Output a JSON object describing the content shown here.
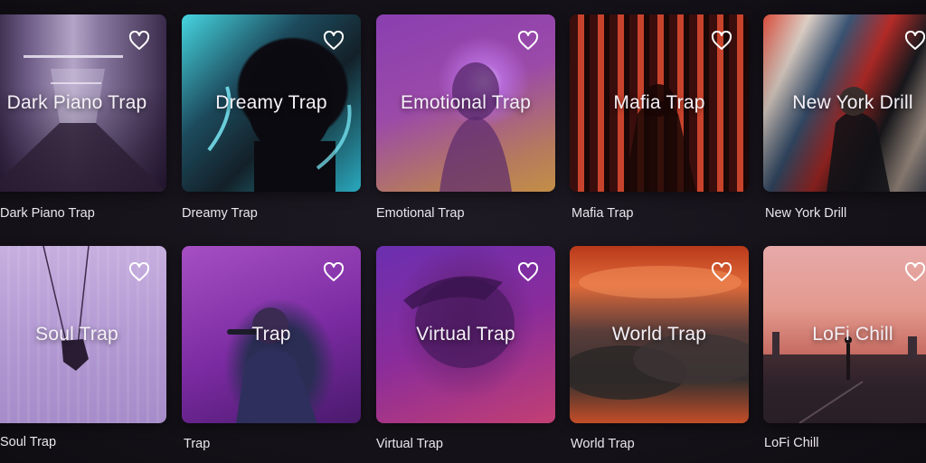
{
  "genres": [
    {
      "id": "dark-piano-trap",
      "overlay": "Dark Piano Trap",
      "caption": "Dark Piano Trap"
    },
    {
      "id": "dreamy-trap",
      "overlay": "Dreamy Trap",
      "caption": "Dreamy Trap"
    },
    {
      "id": "emotional-trap",
      "overlay": "Emotional Trap",
      "caption": "Emotional Trap"
    },
    {
      "id": "mafia-trap",
      "overlay": "Mafia Trap",
      "caption": "Mafia Trap"
    },
    {
      "id": "new-york-drill",
      "overlay": "New York Drill",
      "caption": "New York Drill"
    },
    {
      "id": "soul-trap",
      "overlay": "Soul Trap",
      "caption": "Soul Trap"
    },
    {
      "id": "trap",
      "overlay": "Trap",
      "caption": "Trap"
    },
    {
      "id": "virtual-trap",
      "overlay": "Virtual Trap",
      "caption": "Virtual Trap"
    },
    {
      "id": "world-trap",
      "overlay": "World Trap",
      "caption": "World Trap"
    },
    {
      "id": "lofi-chill",
      "overlay": "LoFi Chill",
      "caption": "LoFi Chill"
    }
  ],
  "icons": {
    "favorite": "heart-outline-icon"
  },
  "colors": {
    "background": "#17141c",
    "text": "#e9e6ec"
  }
}
